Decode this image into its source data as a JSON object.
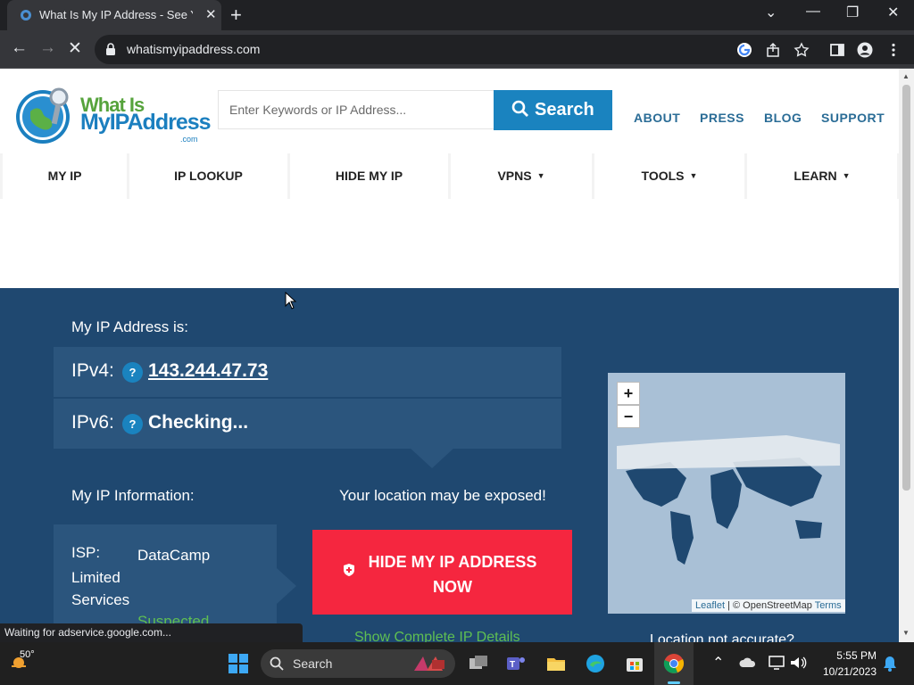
{
  "browser": {
    "tab_title": "What Is My IP Address - See Your...",
    "url": "whatismyipaddress.com",
    "status_text": "Waiting for adservice.google.com..."
  },
  "header": {
    "logo": {
      "line1": "What Is",
      "line2": "MyIPAddress",
      "line3": ".com"
    },
    "search_placeholder": "Enter Keywords or IP Address...",
    "search_button": "Search",
    "links": [
      "ABOUT",
      "PRESS",
      "BLOG",
      "SUPPORT"
    ]
  },
  "nav": [
    {
      "label": "MY IP",
      "dropdown": false
    },
    {
      "label": "IP LOOKUP",
      "dropdown": false
    },
    {
      "label": "HIDE MY IP",
      "dropdown": false
    },
    {
      "label": "VPNS",
      "dropdown": true
    },
    {
      "label": "TOOLS",
      "dropdown": true
    },
    {
      "label": "LEARN",
      "dropdown": true
    }
  ],
  "hero": {
    "ip_heading": "My IP Address is:",
    "ipv4_label": "IPv4:",
    "ipv4_value": "143.244.47.73",
    "ipv6_label": "IPv6:",
    "ipv6_value": "Checking...",
    "help_glyph": "?",
    "info_heading": "My IP Information:",
    "isp_label": "ISP:",
    "isp_value": "DataCamp Limited",
    "services_label": "Services",
    "services_value": "Suspected",
    "exposed_text": "Your location may be exposed!",
    "hide_button": "HIDE MY IP ADDRESS NOW",
    "details_link": "Show Complete IP Details",
    "location_question": "Location not accurate?"
  },
  "map": {
    "zoom_in": "+",
    "zoom_out": "−",
    "attr_leaflet": "Leaflet",
    "attr_osm": "| © OpenStreetMap",
    "attr_terms": "Terms"
  },
  "taskbar": {
    "weather": "50°",
    "search_label": "Search",
    "time": "5:55 PM",
    "date": "10/21/2023"
  },
  "colors": {
    "hero_bg": "#1f4870",
    "accent_blue": "#1a83bf",
    "hide_red": "#f5263f",
    "link_green": "#5fbf52"
  }
}
